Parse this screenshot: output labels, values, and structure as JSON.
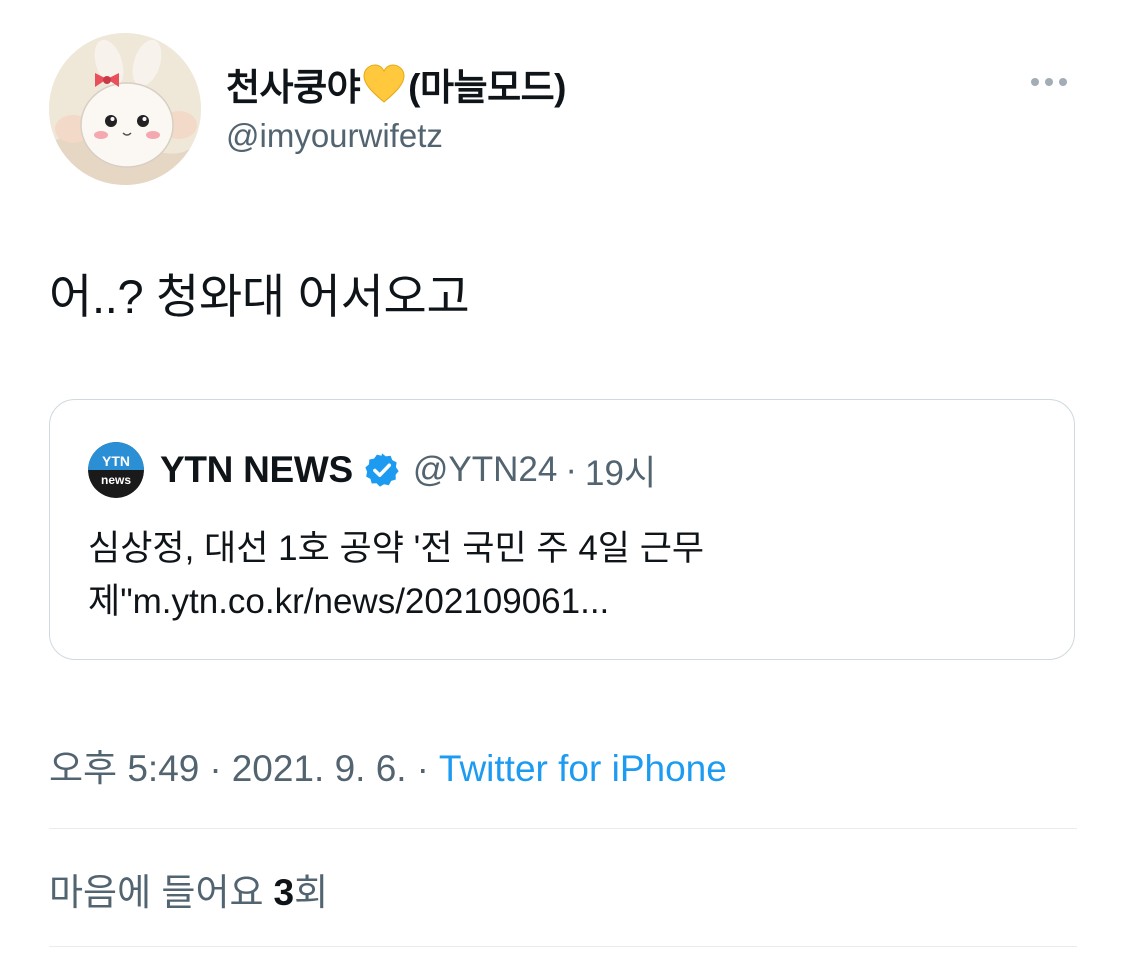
{
  "author": {
    "display_name": "천사쿵야",
    "heart_icon": "yellow-heart-icon",
    "heart_color": "#FFC83D",
    "display_name_suffix": "(마늘모드)",
    "handle": "@imyourwifetz"
  },
  "more_icon": "more-options-icon",
  "tweet_text": "어..? 청와대 어서오고",
  "quote": {
    "avatar_text_top": "YTN",
    "avatar_text_bottom": "news",
    "name": "YTN NEWS",
    "verified_icon": "verified-badge-icon",
    "verified_color": "#1D9BF0",
    "handle": "@YTN24",
    "separator": "·",
    "time": "19시",
    "body_line1": "심상정, 대선 1호 공약 '전 국민 주 4일 근무",
    "body_line2": "제\"m.ytn.co.kr/news/202109061..."
  },
  "meta": {
    "time": "오후 5:49",
    "separator": "·",
    "date": "2021. 9. 6.",
    "source": "Twitter for iPhone"
  },
  "likes": {
    "label": "마음에 들어요",
    "count": "3",
    "unit": "회"
  }
}
